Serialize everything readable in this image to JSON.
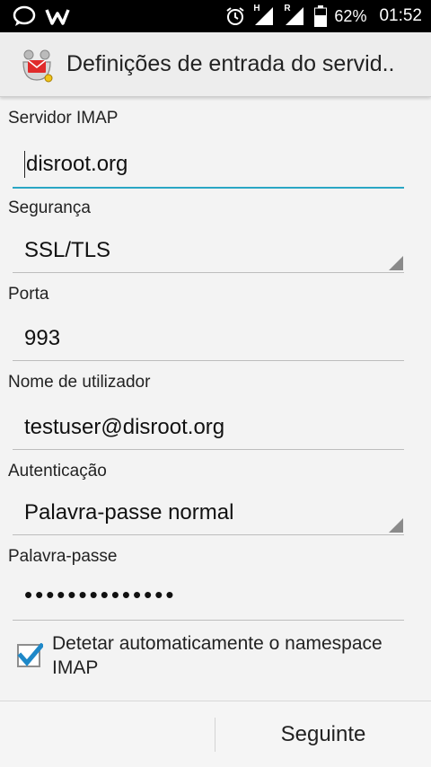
{
  "status_bar": {
    "battery": "62%",
    "time": "01:52",
    "signal_1": "H",
    "signal_2": "R",
    "icons": [
      "chat-icon",
      "w-app-icon",
      "alarm-icon",
      "signal-icon",
      "signal-icon",
      "battery-icon"
    ]
  },
  "app_bar": {
    "title": "Definições de entrada do servid..",
    "icon": "mail-app-icon"
  },
  "form": {
    "imap_server": {
      "label": "Servidor IMAP",
      "value": "disroot.org"
    },
    "security": {
      "label": "Segurança",
      "value": "SSL/TLS"
    },
    "port": {
      "label": "Porta",
      "value": "993"
    },
    "username": {
      "label": "Nome de utilizador",
      "value": "testuser@disroot.org"
    },
    "authentication": {
      "label": "Autenticação",
      "value": "Palavra-passe normal"
    },
    "password": {
      "label": "Palavra-passe",
      "value": "••••••••••••••"
    },
    "auto_namespace": {
      "label": "Detetar automaticamente o namespace IMAP",
      "checked": true
    }
  },
  "footer": {
    "next_label": "Seguinte"
  },
  "colors": {
    "accent": "#2aa6c4",
    "checkbox": "#1e88c8"
  }
}
